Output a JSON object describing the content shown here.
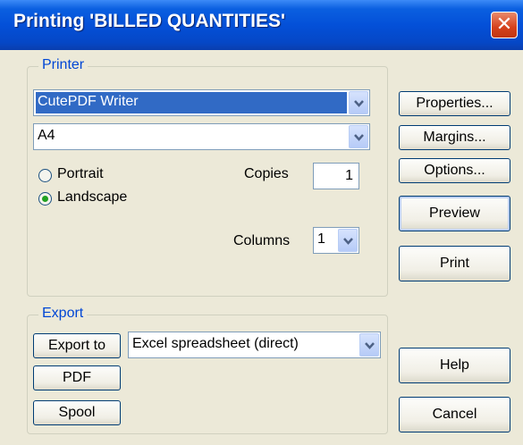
{
  "window": {
    "title": "Printing 'BILLED QUANTITIES'",
    "close_glyph": "✕"
  },
  "printer": {
    "legend": "Printer",
    "printer_name": "CutePDF Writer",
    "paper": "A4",
    "orientation": {
      "portrait": "Portrait",
      "landscape": "Landscape",
      "selected": "landscape"
    },
    "copies_label": "Copies",
    "copies_value": "1",
    "columns_label": "Columns",
    "columns_value": "1"
  },
  "buttons": {
    "properties": "Properties...",
    "margins": "Margins...",
    "options": "Options...",
    "preview": "Preview",
    "print": "Print",
    "help": "Help",
    "cancel": "Cancel"
  },
  "export": {
    "legend": "Export",
    "export_to": "Export to",
    "format": "Excel spreadsheet (direct)",
    "pdf": "PDF",
    "spool": "Spool"
  },
  "colors": {
    "accent": "#0046d5",
    "title_bar": "#0450d8",
    "selection": "#316ac5",
    "radio_dot": "#21a121"
  }
}
